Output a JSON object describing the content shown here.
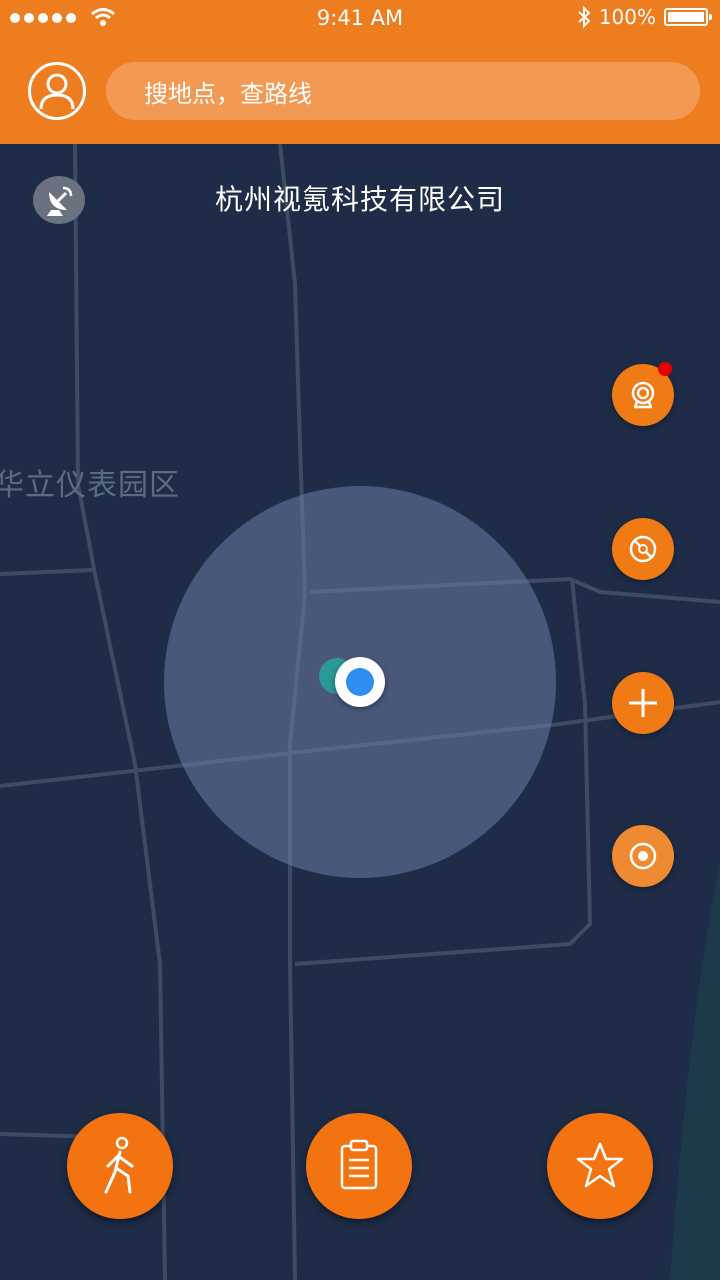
{
  "status_bar": {
    "time": "9:41 AM",
    "battery": "100%"
  },
  "header": {
    "search_placeholder": "搜地点，查路线"
  },
  "map": {
    "current_location": "杭州视氪科技有限公司",
    "area_label": "华立仪表园区"
  },
  "side_controls": [
    "radar-icon",
    "compass-icon",
    "zoom-in-icon",
    "locate-icon"
  ],
  "bottom_actions": [
    "walk-icon",
    "clipboard-icon",
    "star-icon"
  ],
  "colors": {
    "brand": "#ee7d1f",
    "map_bg": "#1e2c47",
    "user_dot": "#2f8ff0"
  }
}
